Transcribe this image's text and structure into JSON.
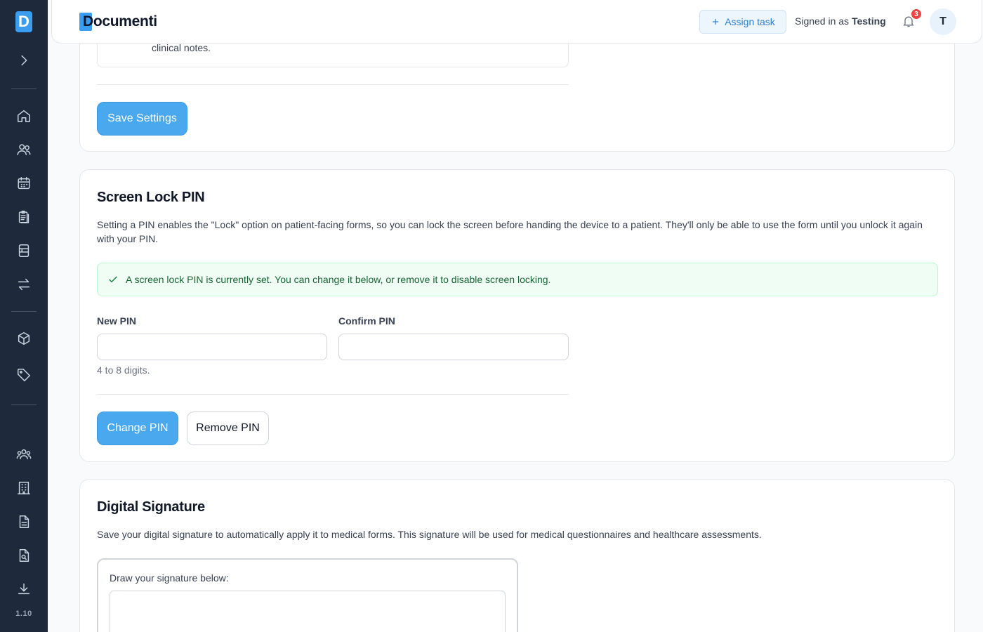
{
  "app": {
    "logo_letter": "D",
    "brand": "Documenti",
    "version": "1.10"
  },
  "header": {
    "assign_label": "Assign task",
    "signed_prefix": "Signed in as",
    "user_name": "Testing",
    "notification_count": "3",
    "avatar_initial": "T"
  },
  "sidebar": {
    "icons": [
      "chevron-right-icon",
      "home-icon",
      "users-icon",
      "calendar-icon",
      "clipboard-icon",
      "form-icon",
      "transfer-icon",
      "cube-icon",
      "tag-icon",
      "team-icon",
      "building-icon",
      "document-icon",
      "search-document-icon",
      "download-icon"
    ]
  },
  "settings_card": {
    "trailing_text": "clinical notes.",
    "save_label": "Save Settings"
  },
  "pin_card": {
    "title": "Screen Lock PIN",
    "description": "Setting a PIN enables the \"Lock\" option on patient-facing forms, so you can lock the screen before handing the device to a patient. They'll only be able to use the form until you unlock it again with your PIN.",
    "status": "A screen lock PIN is currently set. You can change it below, or remove it to disable screen locking.",
    "new_pin_label": "New PIN",
    "confirm_pin_label": "Confirm PIN",
    "new_pin_value": "",
    "confirm_pin_value": "",
    "hint": "4 to 8 digits.",
    "change_label": "Change PIN",
    "remove_label": "Remove PIN"
  },
  "signature_card": {
    "title": "Digital Signature",
    "description": "Save your digital signature to automatically apply it to medical forms. This signature will be used for medical questionnaires and healthcare assessments.",
    "draw_label": "Draw your signature below:"
  },
  "colors": {
    "primary": "#4aa8ee",
    "sidebar": "#1e293b",
    "success_bg": "#f0fdf4",
    "badge": "#ef4444"
  }
}
